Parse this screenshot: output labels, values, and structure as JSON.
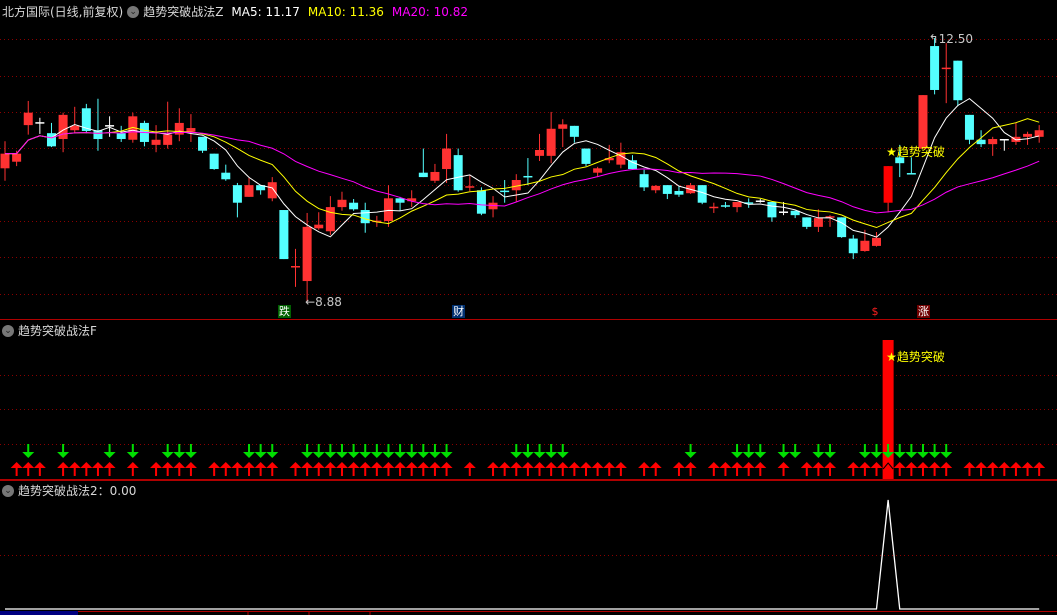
{
  "header": {
    "title": "北方国际(日线,前复权)",
    "indicator": "趋势突破战法Z",
    "ma5_label": "MA5:",
    "ma5_value": "11.17",
    "ma10_label": "MA10:",
    "ma10_value": "11.36",
    "ma20_label": "MA20:",
    "ma20_value": "10.82",
    "collapse_icon": "chevron-down-circle-icon"
  },
  "colors": {
    "up": "#ff3232",
    "down": "#54ffff",
    "flat": "#ffffff",
    "ma5": "#ffffff",
    "ma10": "#ffff00",
    "ma20": "#ff00ff",
    "grid": "#8a0000",
    "border": "#b00000",
    "signal_bar": "#ff0000",
    "up_arrow": "#ff0000",
    "down_arrow": "#00dd00",
    "label": "#ffff00"
  },
  "chart_data": [
    {
      "type": "candlestick",
      "title": "趋势突破战法Z",
      "ma_periods": [
        5,
        10,
        20
      ],
      "ylim": [
        8.88,
        12.5
      ],
      "grid": true,
      "ohlc_fields": [
        "open",
        "high",
        "low",
        "close"
      ],
      "ohlc": [
        [
          10.72,
          11.09,
          10.55,
          10.92
        ],
        [
          10.81,
          10.96,
          10.75,
          10.92
        ],
        [
          11.31,
          11.64,
          11.18,
          11.48
        ],
        [
          11.34,
          11.41,
          11.19,
          11.34
        ],
        [
          11.2,
          11.34,
          11.01,
          11.02
        ],
        [
          11.12,
          11.48,
          10.94,
          11.45
        ],
        [
          11.24,
          11.56,
          11.2,
          11.3
        ],
        [
          11.54,
          11.6,
          11.2,
          11.23
        ],
        [
          11.24,
          11.67,
          10.96,
          11.12
        ],
        [
          11.3,
          11.43,
          11.15,
          11.3
        ],
        [
          11.2,
          11.3,
          11.08,
          11.12
        ],
        [
          11.11,
          11.48,
          11.07,
          11.43
        ],
        [
          11.34,
          11.37,
          11.02,
          11.08
        ],
        [
          11.04,
          11.31,
          10.94,
          11.11
        ],
        [
          11.04,
          11.63,
          10.99,
          11.18
        ],
        [
          11.18,
          11.54,
          11.09,
          11.34
        ],
        [
          11.22,
          11.46,
          11.08,
          11.27
        ],
        [
          11.15,
          11.15,
          10.93,
          10.96
        ],
        [
          10.92,
          10.92,
          10.7,
          10.71
        ],
        [
          10.66,
          10.77,
          10.55,
          10.57
        ],
        [
          10.49,
          10.52,
          10.05,
          10.25
        ],
        [
          10.33,
          10.59,
          10.33,
          10.49
        ],
        [
          10.49,
          10.49,
          10.36,
          10.42
        ],
        [
          10.31,
          10.6,
          10.27,
          10.53
        ],
        [
          10.15,
          10.15,
          9.48,
          9.48
        ],
        [
          9.37,
          9.62,
          9.1,
          9.38
        ],
        [
          9.18,
          10.11,
          8.88,
          9.92
        ],
        [
          9.9,
          10.12,
          9.88,
          9.95
        ],
        [
          9.86,
          10.34,
          9.81,
          10.19
        ],
        [
          10.19,
          10.4,
          10.14,
          10.29
        ],
        [
          10.25,
          10.3,
          10.14,
          10.16
        ],
        [
          10.15,
          10.25,
          9.84,
          9.97
        ],
        [
          9.99,
          10.07,
          9.92,
          10.0
        ],
        [
          10.0,
          10.49,
          9.92,
          10.31
        ],
        [
          10.31,
          10.33,
          10.14,
          10.25
        ],
        [
          10.27,
          10.42,
          10.19,
          10.31
        ],
        [
          10.66,
          10.99,
          10.6,
          10.6
        ],
        [
          10.55,
          10.78,
          10.52,
          10.67
        ],
        [
          10.71,
          11.19,
          10.52,
          10.99
        ],
        [
          10.9,
          10.99,
          10.4,
          10.42
        ],
        [
          10.46,
          10.63,
          10.41,
          10.47
        ],
        [
          10.42,
          10.46,
          10.08,
          10.1
        ],
        [
          10.16,
          10.34,
          10.05,
          10.25
        ],
        [
          10.41,
          10.56,
          10.25,
          10.4
        ],
        [
          10.42,
          10.64,
          10.26,
          10.56
        ],
        [
          10.61,
          10.86,
          10.49,
          10.6
        ],
        [
          10.89,
          11.19,
          10.82,
          10.97
        ],
        [
          10.89,
          11.49,
          10.79,
          11.26
        ],
        [
          11.26,
          11.39,
          11.01,
          11.32
        ],
        [
          11.3,
          11.3,
          11.07,
          11.15
        ],
        [
          10.99,
          10.99,
          10.75,
          10.78
        ],
        [
          10.66,
          10.74,
          10.6,
          10.72
        ],
        [
          10.83,
          11.04,
          10.79,
          10.86
        ],
        [
          10.77,
          11.07,
          10.72,
          10.94
        ],
        [
          10.83,
          10.9,
          10.7,
          10.71
        ],
        [
          10.64,
          10.7,
          10.41,
          10.46
        ],
        [
          10.42,
          10.49,
          10.38,
          10.48
        ],
        [
          10.49,
          10.49,
          10.3,
          10.37
        ],
        [
          10.41,
          10.48,
          10.33,
          10.36
        ],
        [
          10.38,
          10.52,
          10.37,
          10.49
        ],
        [
          10.49,
          10.49,
          10.23,
          10.25
        ],
        [
          10.18,
          10.25,
          10.11,
          10.19
        ],
        [
          10.21,
          10.26,
          10.18,
          10.2
        ],
        [
          10.19,
          10.26,
          10.12,
          10.26
        ],
        [
          10.25,
          10.31,
          10.18,
          10.24
        ],
        [
          10.27,
          10.3,
          10.25,
          10.27
        ],
        [
          10.26,
          10.26,
          9.99,
          10.05
        ],
        [
          10.12,
          10.26,
          10.08,
          10.12
        ],
        [
          10.14,
          10.14,
          10.04,
          10.08
        ],
        [
          10.05,
          10.05,
          9.89,
          9.92
        ],
        [
          9.92,
          10.16,
          9.85,
          10.04
        ],
        [
          10.05,
          10.08,
          9.92,
          10.06
        ],
        [
          10.05,
          10.05,
          9.77,
          9.78
        ],
        [
          9.76,
          9.81,
          9.48,
          9.56
        ],
        [
          9.59,
          9.88,
          9.58,
          9.73
        ],
        [
          9.66,
          9.85,
          9.65,
          9.77
        ],
        [
          10.25,
          10.75,
          10.12,
          10.75
        ],
        [
          10.87,
          11.04,
          10.6,
          10.79
        ],
        [
          10.65,
          10.87,
          10.64,
          10.64
        ],
        [
          10.99,
          11.72,
          10.99,
          11.72
        ],
        [
          12.39,
          12.5,
          11.73,
          11.79
        ],
        [
          12.08,
          12.43,
          11.61,
          12.09
        ],
        [
          12.19,
          12.19,
          11.57,
          11.65
        ],
        [
          11.45,
          11.45,
          11.05,
          11.11
        ],
        [
          11.11,
          11.24,
          11.01,
          11.05
        ],
        [
          11.05,
          11.15,
          10.89,
          11.12
        ],
        [
          11.11,
          11.12,
          10.96,
          11.11
        ],
        [
          11.08,
          11.34,
          11.04,
          11.15
        ],
        [
          11.15,
          11.22,
          11.04,
          11.19
        ],
        [
          11.15,
          11.31,
          11.07,
          11.24
        ]
      ],
      "high_label": "12.50",
      "high_index": 80,
      "low_label": "8.88",
      "low_index": 26,
      "signal_index": 76,
      "signal_label": "趋势突破",
      "markers": [
        {
          "index": 24,
          "text": "跌",
          "bg": "#006000",
          "fg": "#ffffff"
        },
        {
          "index": 39,
          "text": "财",
          "bg": "#003070",
          "fg": "#ffffff"
        },
        {
          "index": 75,
          "text": "$",
          "bg": "#000000",
          "fg": "#ff2020"
        },
        {
          "index": 79,
          "text": "涨",
          "bg": "#700000",
          "fg": "#ffffff"
        }
      ]
    },
    {
      "type": "signal",
      "title": "趋势突破战法F",
      "bar_index": 76,
      "bar_label": "趋势突破",
      "up_arrows": [
        1,
        2,
        3,
        5,
        6,
        7,
        8,
        9,
        11,
        13,
        14,
        15,
        16,
        18,
        19,
        20,
        21,
        22,
        23,
        25,
        26,
        27,
        28,
        29,
        30,
        31,
        32,
        33,
        34,
        35,
        36,
        37,
        38,
        40,
        42,
        43,
        44,
        45,
        46,
        47,
        48,
        49,
        50,
        51,
        52,
        53,
        55,
        56,
        58,
        59,
        61,
        62,
        63,
        64,
        65,
        67,
        69,
        70,
        71,
        73,
        74,
        75,
        76,
        77,
        78,
        79,
        80,
        81,
        83,
        84,
        85,
        86,
        87,
        88,
        89
      ],
      "down_arrows": [
        2,
        5,
        9,
        11,
        14,
        15,
        16,
        21,
        22,
        23,
        26,
        27,
        28,
        29,
        30,
        31,
        32,
        33,
        34,
        35,
        36,
        37,
        38,
        44,
        45,
        46,
        47,
        48,
        59,
        63,
        64,
        65,
        67,
        68,
        70,
        71,
        74,
        75,
        76,
        77,
        78,
        79,
        80,
        81
      ]
    },
    {
      "type": "line",
      "title": "趋势突破战法2",
      "separator": "：",
      "value_label": "0.00",
      "ylim": [
        0,
        1
      ],
      "values": [
        0,
        0,
        0,
        0,
        0,
        0,
        0,
        0,
        0,
        0,
        0,
        0,
        0,
        0,
        0,
        0,
        0,
        0,
        0,
        0,
        0,
        0,
        0,
        0,
        0,
        0,
        0,
        0,
        0,
        0,
        0,
        0,
        0,
        0,
        0,
        0,
        0,
        0,
        0,
        0,
        0,
        0,
        0,
        0,
        0,
        0,
        0,
        0,
        0,
        0,
        0,
        0,
        0,
        0,
        0,
        0,
        0,
        0,
        0,
        0,
        0,
        0,
        0,
        0,
        0,
        0,
        0,
        0,
        0,
        0,
        0,
        0,
        0,
        0,
        0,
        0,
        1,
        0,
        0,
        0,
        0,
        0,
        0,
        0,
        0,
        0,
        0,
        0,
        0,
        0
      ]
    }
  ]
}
